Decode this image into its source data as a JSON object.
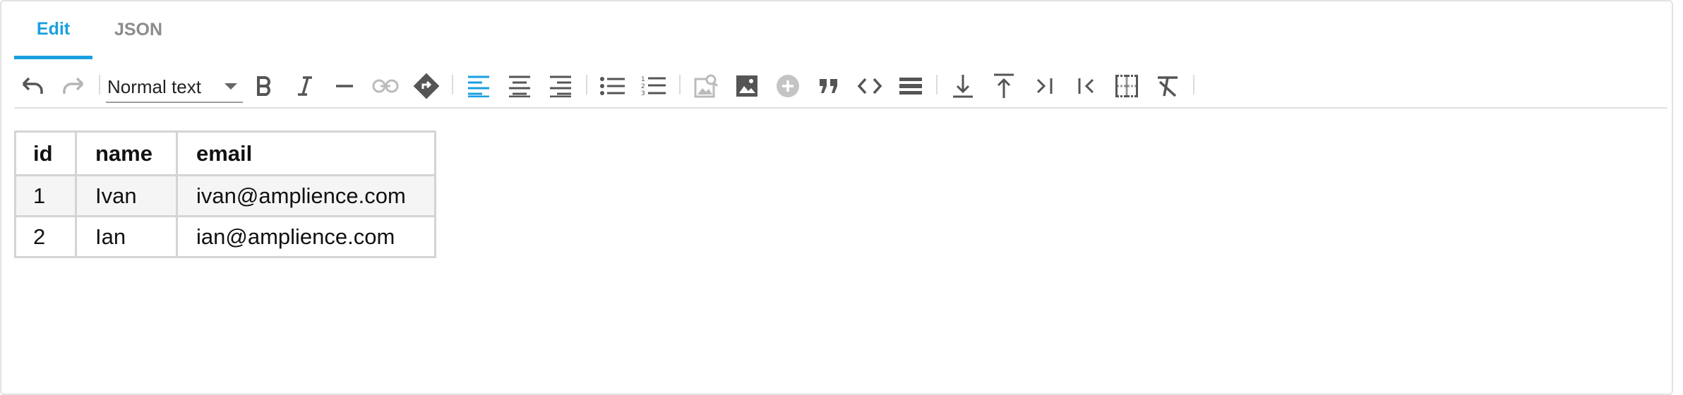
{
  "tabs": [
    {
      "label": "Edit",
      "active": true
    },
    {
      "label": "JSON",
      "active": false
    }
  ],
  "toolbar": {
    "block_format": "Normal text",
    "icons": [
      "undo-icon",
      "redo-icon",
      "bold-icon",
      "italic-icon",
      "horizontal-rule-icon",
      "link-icon",
      "anchor-icon",
      "align-left-icon",
      "align-center-icon",
      "align-right-icon",
      "bullet-list-icon",
      "numbered-list-icon",
      "insert-image-search-icon",
      "image-icon",
      "add-circle-icon",
      "blockquote-icon",
      "code-icon",
      "divider-icon",
      "insert-row-below-icon",
      "insert-row-above-icon",
      "insert-column-after-icon",
      "insert-column-before-icon",
      "table-icon",
      "clear-format-icon"
    ],
    "accent_color": "#1a9fe0"
  },
  "table": {
    "headers": [
      "id",
      "name",
      "email"
    ],
    "rows": [
      [
        "1",
        "Ivan",
        "ivan@amplience.com"
      ],
      [
        "2",
        "Ian",
        "ian@amplience.com"
      ]
    ]
  }
}
